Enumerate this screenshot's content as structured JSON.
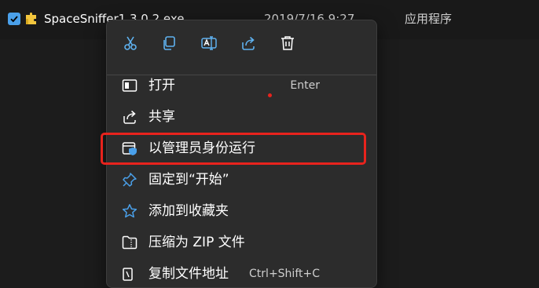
{
  "file_row": {
    "name": "SpaceSniffer1.3.0.2.exe",
    "date": "2019/7/16 9:27",
    "type": "应用程序",
    "checked": true
  },
  "quick_actions": [
    {
      "icon": "cut-icon"
    },
    {
      "icon": "copy-icon"
    },
    {
      "icon": "rename-icon"
    },
    {
      "icon": "share-icon"
    },
    {
      "icon": "delete-icon"
    }
  ],
  "menu_items": [
    {
      "label": "打开",
      "shortcut": "Enter",
      "icon": "open-icon"
    },
    {
      "label": "共享",
      "shortcut": "",
      "icon": "share-icon"
    },
    {
      "label": "以管理员身份运行",
      "shortcut": "",
      "icon": "run-as-admin-shield-icon",
      "highlighted": true
    },
    {
      "label": "固定到“开始”",
      "shortcut": "",
      "icon": "pin-icon"
    },
    {
      "label": "添加到收藏夹",
      "shortcut": "",
      "icon": "star-icon"
    },
    {
      "label": "压缩为 ZIP 文件",
      "shortcut": "",
      "icon": "zip-folder-icon"
    },
    {
      "label": "复制文件地址",
      "shortcut": "Ctrl+Shift+C",
      "icon": "copy-path-icon"
    }
  ],
  "colors": {
    "background": "#1c1c1c",
    "menu_background": "#2c2c2c",
    "accent_blue": "#4aa0ea",
    "highlight_red": "#e8231d"
  }
}
